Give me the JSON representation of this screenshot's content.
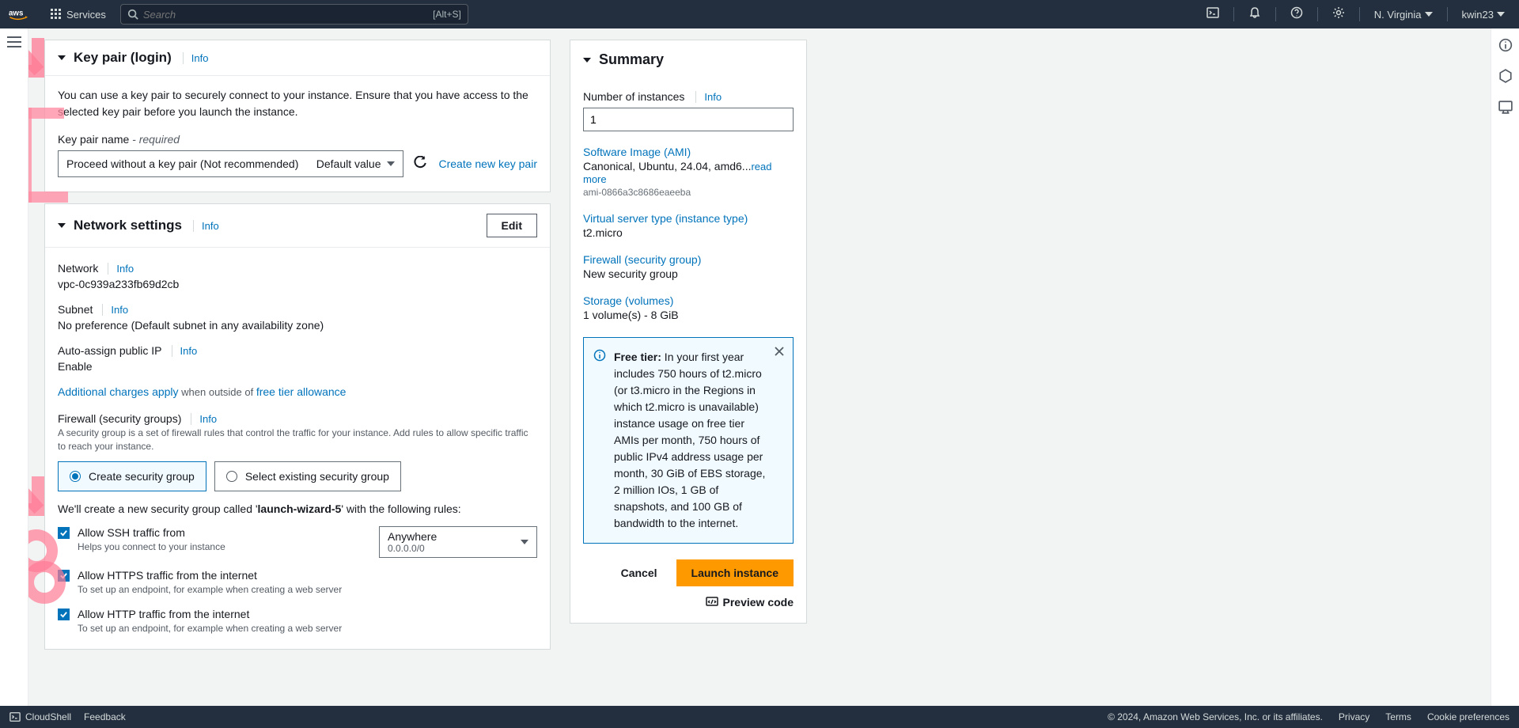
{
  "topbar": {
    "services": "Services",
    "search_placeholder": "Search",
    "search_hint": "[Alt+S]",
    "region": "N. Virginia",
    "user": "kwin23"
  },
  "keypair": {
    "title": "Key pair (login)",
    "info": "Info",
    "desc": "You can use a key pair to securely connect to your instance. Ensure that you have access to the selected key pair before you launch the instance.",
    "name_label": "Key pair name",
    "required": "- required",
    "selected": "Proceed without a key pair (Not recommended)",
    "default_value": "Default value",
    "create_link": "Create new key pair"
  },
  "network": {
    "title": "Network settings",
    "info": "Info",
    "edit": "Edit",
    "network_label": "Network",
    "network_value": "vpc-0c939a233fb69d2cb",
    "subnet_label": "Subnet",
    "subnet_value": "No preference (Default subnet in any availability zone)",
    "autoip_label": "Auto-assign public IP",
    "autoip_value": "Enable",
    "charges_link": "Additional charges apply",
    "charges_mid": " when outside of ",
    "charges_link2": "free tier allowance",
    "firewall_label": "Firewall (security groups)",
    "firewall_help": "A security group is a set of firewall rules that control the traffic for your instance. Add rules to allow specific traffic to reach your instance.",
    "radio_create": "Create security group",
    "radio_existing": "Select existing security group",
    "sg_note_pre": "We'll create a new security group called '",
    "sg_name": "launch-wizard-5",
    "sg_note_post": "' with the following rules:",
    "ssh_label": "Allow SSH traffic from",
    "ssh_help": "Helps you connect to your instance",
    "ssh_source_label": "Anywhere",
    "ssh_source_cidr": "0.0.0.0/0",
    "https_label": "Allow HTTPS traffic from the internet",
    "https_help": "To set up an endpoint, for example when creating a web server",
    "http_label": "Allow HTTP traffic from the internet",
    "http_help": "To set up an endpoint, for example when creating a web server"
  },
  "summary": {
    "title": "Summary",
    "num_label": "Number of instances",
    "info": "Info",
    "num_value": "1",
    "ami_label": "Software Image (AMI)",
    "ami_value": "Canonical, Ubuntu, 24.04, amd6...",
    "read_more": "read more",
    "ami_id": "ami-0866a3c8686eaeeba",
    "type_label": "Virtual server type (instance type)",
    "type_value": "t2.micro",
    "fw_label": "Firewall (security group)",
    "fw_value": "New security group",
    "storage_label": "Storage (volumes)",
    "storage_value": "1 volume(s) - 8 GiB",
    "freetier_head": "Free tier:",
    "freetier_text": " In your first year includes 750 hours of t2.micro (or t3.micro in the Regions in which t2.micro is unavailable) instance usage on free tier AMIs per month, 750 hours of public IPv4 address usage per month, 30 GiB of EBS storage, 2 million IOs, 1 GB of snapshots, and 100 GB of bandwidth to the internet.",
    "cancel": "Cancel",
    "launch": "Launch instance",
    "preview": "Preview code"
  },
  "bottom": {
    "cloudshell": "CloudShell",
    "feedback": "Feedback",
    "copyright": "© 2024, Amazon Web Services, Inc. or its affiliates.",
    "privacy": "Privacy",
    "terms": "Terms",
    "cookie": "Cookie preferences"
  }
}
